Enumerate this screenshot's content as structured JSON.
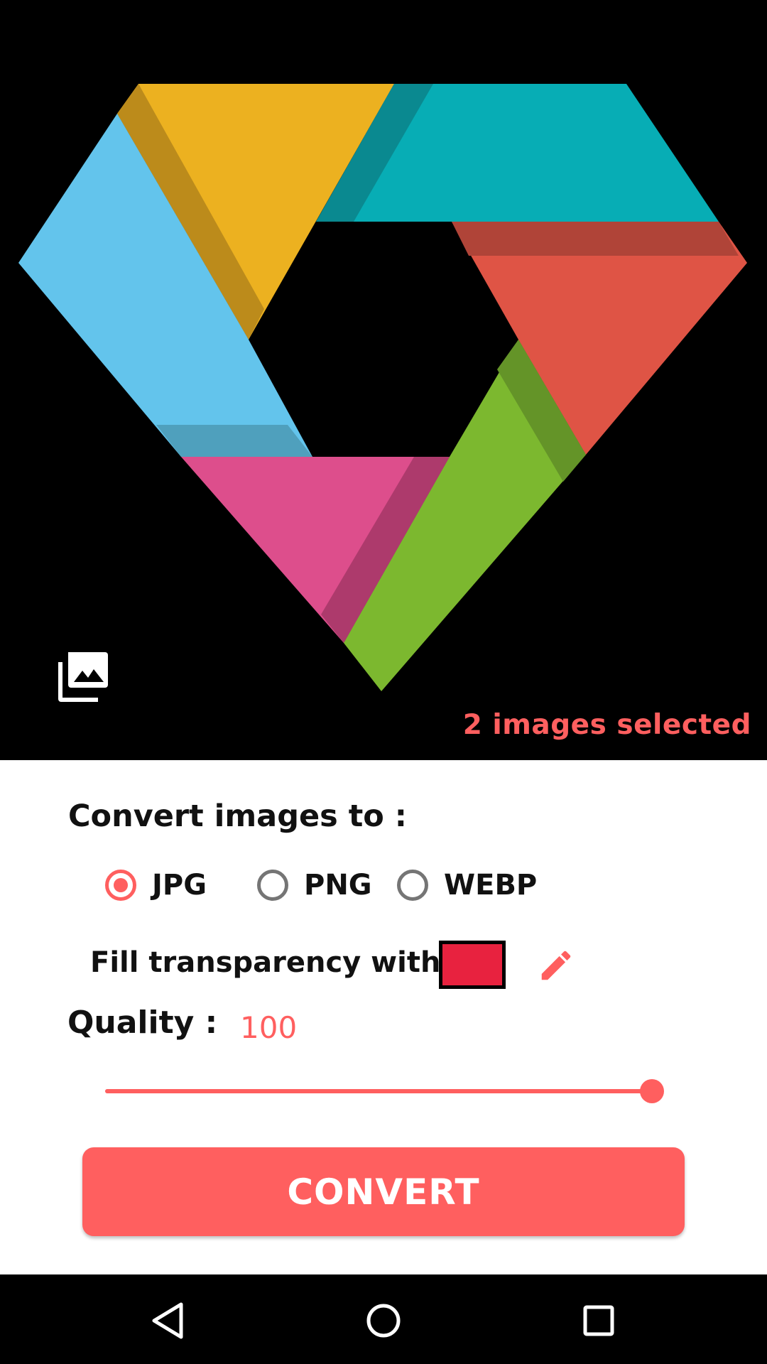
{
  "preview": {
    "image_description_name": "colorful-diamond-logo",
    "selected_count_text": "2 images selected",
    "gallery_icon": "photo-library-icon"
  },
  "settings": {
    "convert_label": "Convert images to :",
    "formats": [
      {
        "label": "JPG",
        "checked": true
      },
      {
        "label": "PNG",
        "checked": false
      },
      {
        "label": "WEBP",
        "checked": false
      }
    ],
    "fill_label": "Fill transparency with -",
    "fill_color": "#e8223f",
    "edit_icon": "pencil-icon",
    "quality_label": "Quality :",
    "quality_value": "100",
    "quality_fraction": 1.0
  },
  "actions": {
    "convert_label": "CONVERT"
  },
  "navbar": {
    "back_icon": "back-triangle-icon",
    "home_icon": "home-circle-icon",
    "recents_icon": "recents-square-icon"
  },
  "colors": {
    "accent": "#ff5f5f",
    "background_dark": "#000000",
    "text_dark": "#111111",
    "radio_unchecked": "#757575"
  }
}
